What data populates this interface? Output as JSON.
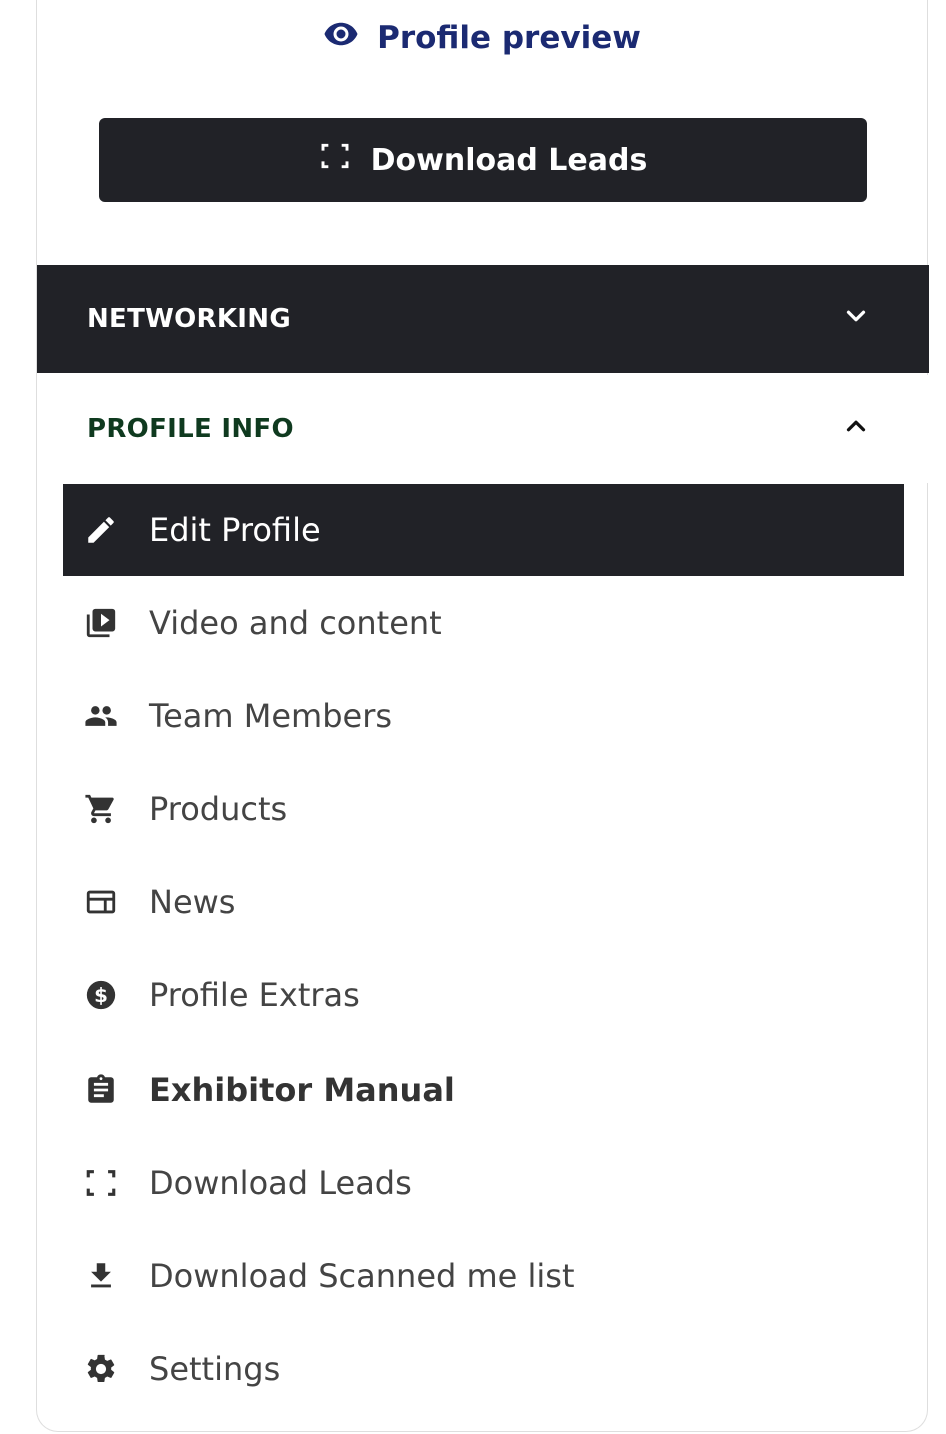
{
  "preview": {
    "label": "Profile preview",
    "icon": "eye-icon"
  },
  "download_button": {
    "label": "Download Leads",
    "icon": "scan-frame-icon"
  },
  "sections": [
    {
      "label": "NETWORKING",
      "state": "collapsed",
      "icon": "chevron-down-icon"
    },
    {
      "label": "PROFILE INFO",
      "state": "expanded",
      "icon": "chevron-up-icon"
    }
  ],
  "menu": [
    {
      "label": "Edit Profile",
      "icon": "pencil-icon",
      "active": true
    },
    {
      "label": "Video and content",
      "icon": "video-library-icon"
    },
    {
      "label": "Team Members",
      "icon": "people-icon"
    },
    {
      "label": "Products",
      "icon": "cart-icon"
    },
    {
      "label": "News",
      "icon": "newspaper-icon"
    },
    {
      "label": "Profile Extras",
      "icon": "dollar-circle-icon"
    },
    {
      "label": "Exhibitor Manual",
      "icon": "clipboard-icon",
      "bold": true
    },
    {
      "label": "Download Leads",
      "icon": "scan-frame-icon"
    },
    {
      "label": "Download Scanned me list",
      "icon": "download-icon"
    },
    {
      "label": "Settings",
      "icon": "gear-icon"
    }
  ],
  "colors": {
    "accent_navy": "#1b2a72",
    "dark": "#212227",
    "section_green": "#0f3a1f",
    "text": "#444444"
  }
}
